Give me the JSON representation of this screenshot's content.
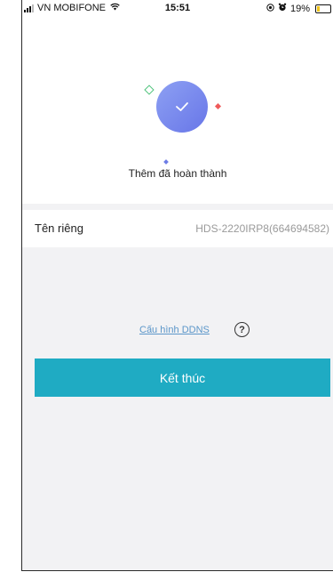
{
  "status_bar": {
    "carrier": "VN MOBIFONE",
    "time": "15:51",
    "battery": "19%",
    "battery_level": 0.19
  },
  "success": {
    "title": "Thêm đã hoàn thành"
  },
  "device": {
    "name_label": "Tên riêng",
    "name_value": "HDS-2220IRP8(664694582)"
  },
  "ddns": {
    "link_label": "Cấu hình DDNS",
    "help_symbol": "?"
  },
  "actions": {
    "finish_label": "Kết thúc"
  },
  "colors": {
    "accent": "#1fabc3",
    "check_circle": "#7584ee",
    "link": "#5b96c9"
  },
  "icons": {
    "status_left": [
      "signal-icon",
      "wifi-icon"
    ],
    "status_right": [
      "location-icon",
      "alarm-icon",
      "battery-icon"
    ],
    "success": "checkmark-icon",
    "help": "question-circle-icon"
  }
}
